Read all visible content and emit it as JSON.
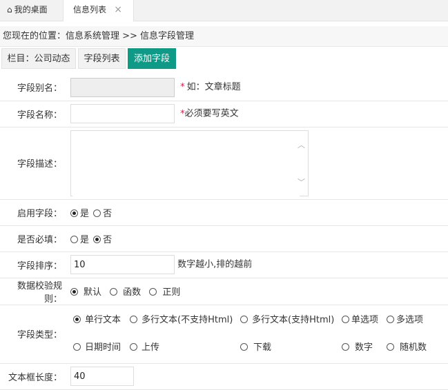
{
  "tabs": {
    "home_label": "我的桌面",
    "active_label": "信息列表",
    "close_glyph": "×"
  },
  "breadcrumb": "您现在的位置：信息系统管理 >> 信息字段管理",
  "toolbar": {
    "column_label": "栏目：公司动态",
    "list_label": "字段列表",
    "add_label": "添加字段"
  },
  "form": {
    "alias": {
      "label": "字段别名：",
      "value": "",
      "required_mark": "*",
      "hint": "如：文章标题"
    },
    "name": {
      "label": "字段名称：",
      "value": "",
      "required_mark": "*",
      "hint": "必须要写英文"
    },
    "description": {
      "label": "字段描述：",
      "value": ""
    },
    "enabled": {
      "label": "启用字段：",
      "options": [
        "是",
        "否"
      ],
      "selected": "是"
    },
    "required": {
      "label": "是否必填：",
      "options": [
        "是",
        "否"
      ],
      "selected": "否"
    },
    "sort": {
      "label": "字段排序：",
      "value": "10",
      "hint": "数字越小,排的越前"
    },
    "validation": {
      "label": "数据校验规则：",
      "options": [
        "默认",
        "函数",
        "正则"
      ],
      "selected": "默认"
    },
    "field_type": {
      "label": "字段类型：",
      "options": [
        "单行文本",
        "多行文本(不支持Html)",
        "多行文本(支持Html)",
        "单选项",
        "多选项",
        "日期时间",
        "上传",
        "下载",
        "数字",
        "随机数"
      ],
      "selected": "单行文本"
    },
    "text_length": {
      "label": "文本框长度：",
      "value": "40"
    }
  },
  "icons": {
    "home": "home-icon",
    "close": "close-icon",
    "scroll_up": "chevron-up-icon",
    "scroll_down": "chevron-down-icon"
  }
}
